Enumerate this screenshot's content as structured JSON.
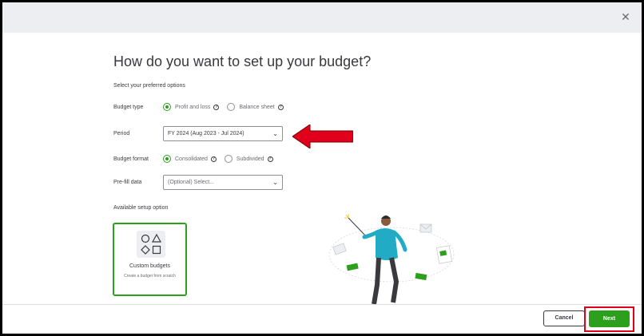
{
  "dialog": {
    "title": "How do you want to set up your budget?",
    "subtitle": "Select your preferred options",
    "close_icon": "close-icon"
  },
  "budget_type": {
    "label": "Budget type",
    "options": [
      "Profit and loss",
      "Balance sheet"
    ],
    "selected": "Profit and loss"
  },
  "period": {
    "label": "Period",
    "value": "FY 2024 (Aug 2023 - Jul 2024)"
  },
  "budget_format": {
    "label": "Budget format",
    "options": [
      "Consolidated",
      "Subdivided"
    ],
    "selected": "Consolidated"
  },
  "prefill": {
    "label": "Pre-fill data",
    "placeholder": "(Optional) Select..."
  },
  "setup": {
    "label": "Available setup option",
    "card_title": "Custom budgets",
    "card_subtitle": "Create a budget from scratch"
  },
  "footer": {
    "cancel_label": "Cancel",
    "next_label": "Next"
  },
  "colors": {
    "accent": "#2ca01c",
    "highlight": "#e0001b",
    "arrow": "#e0001b"
  }
}
